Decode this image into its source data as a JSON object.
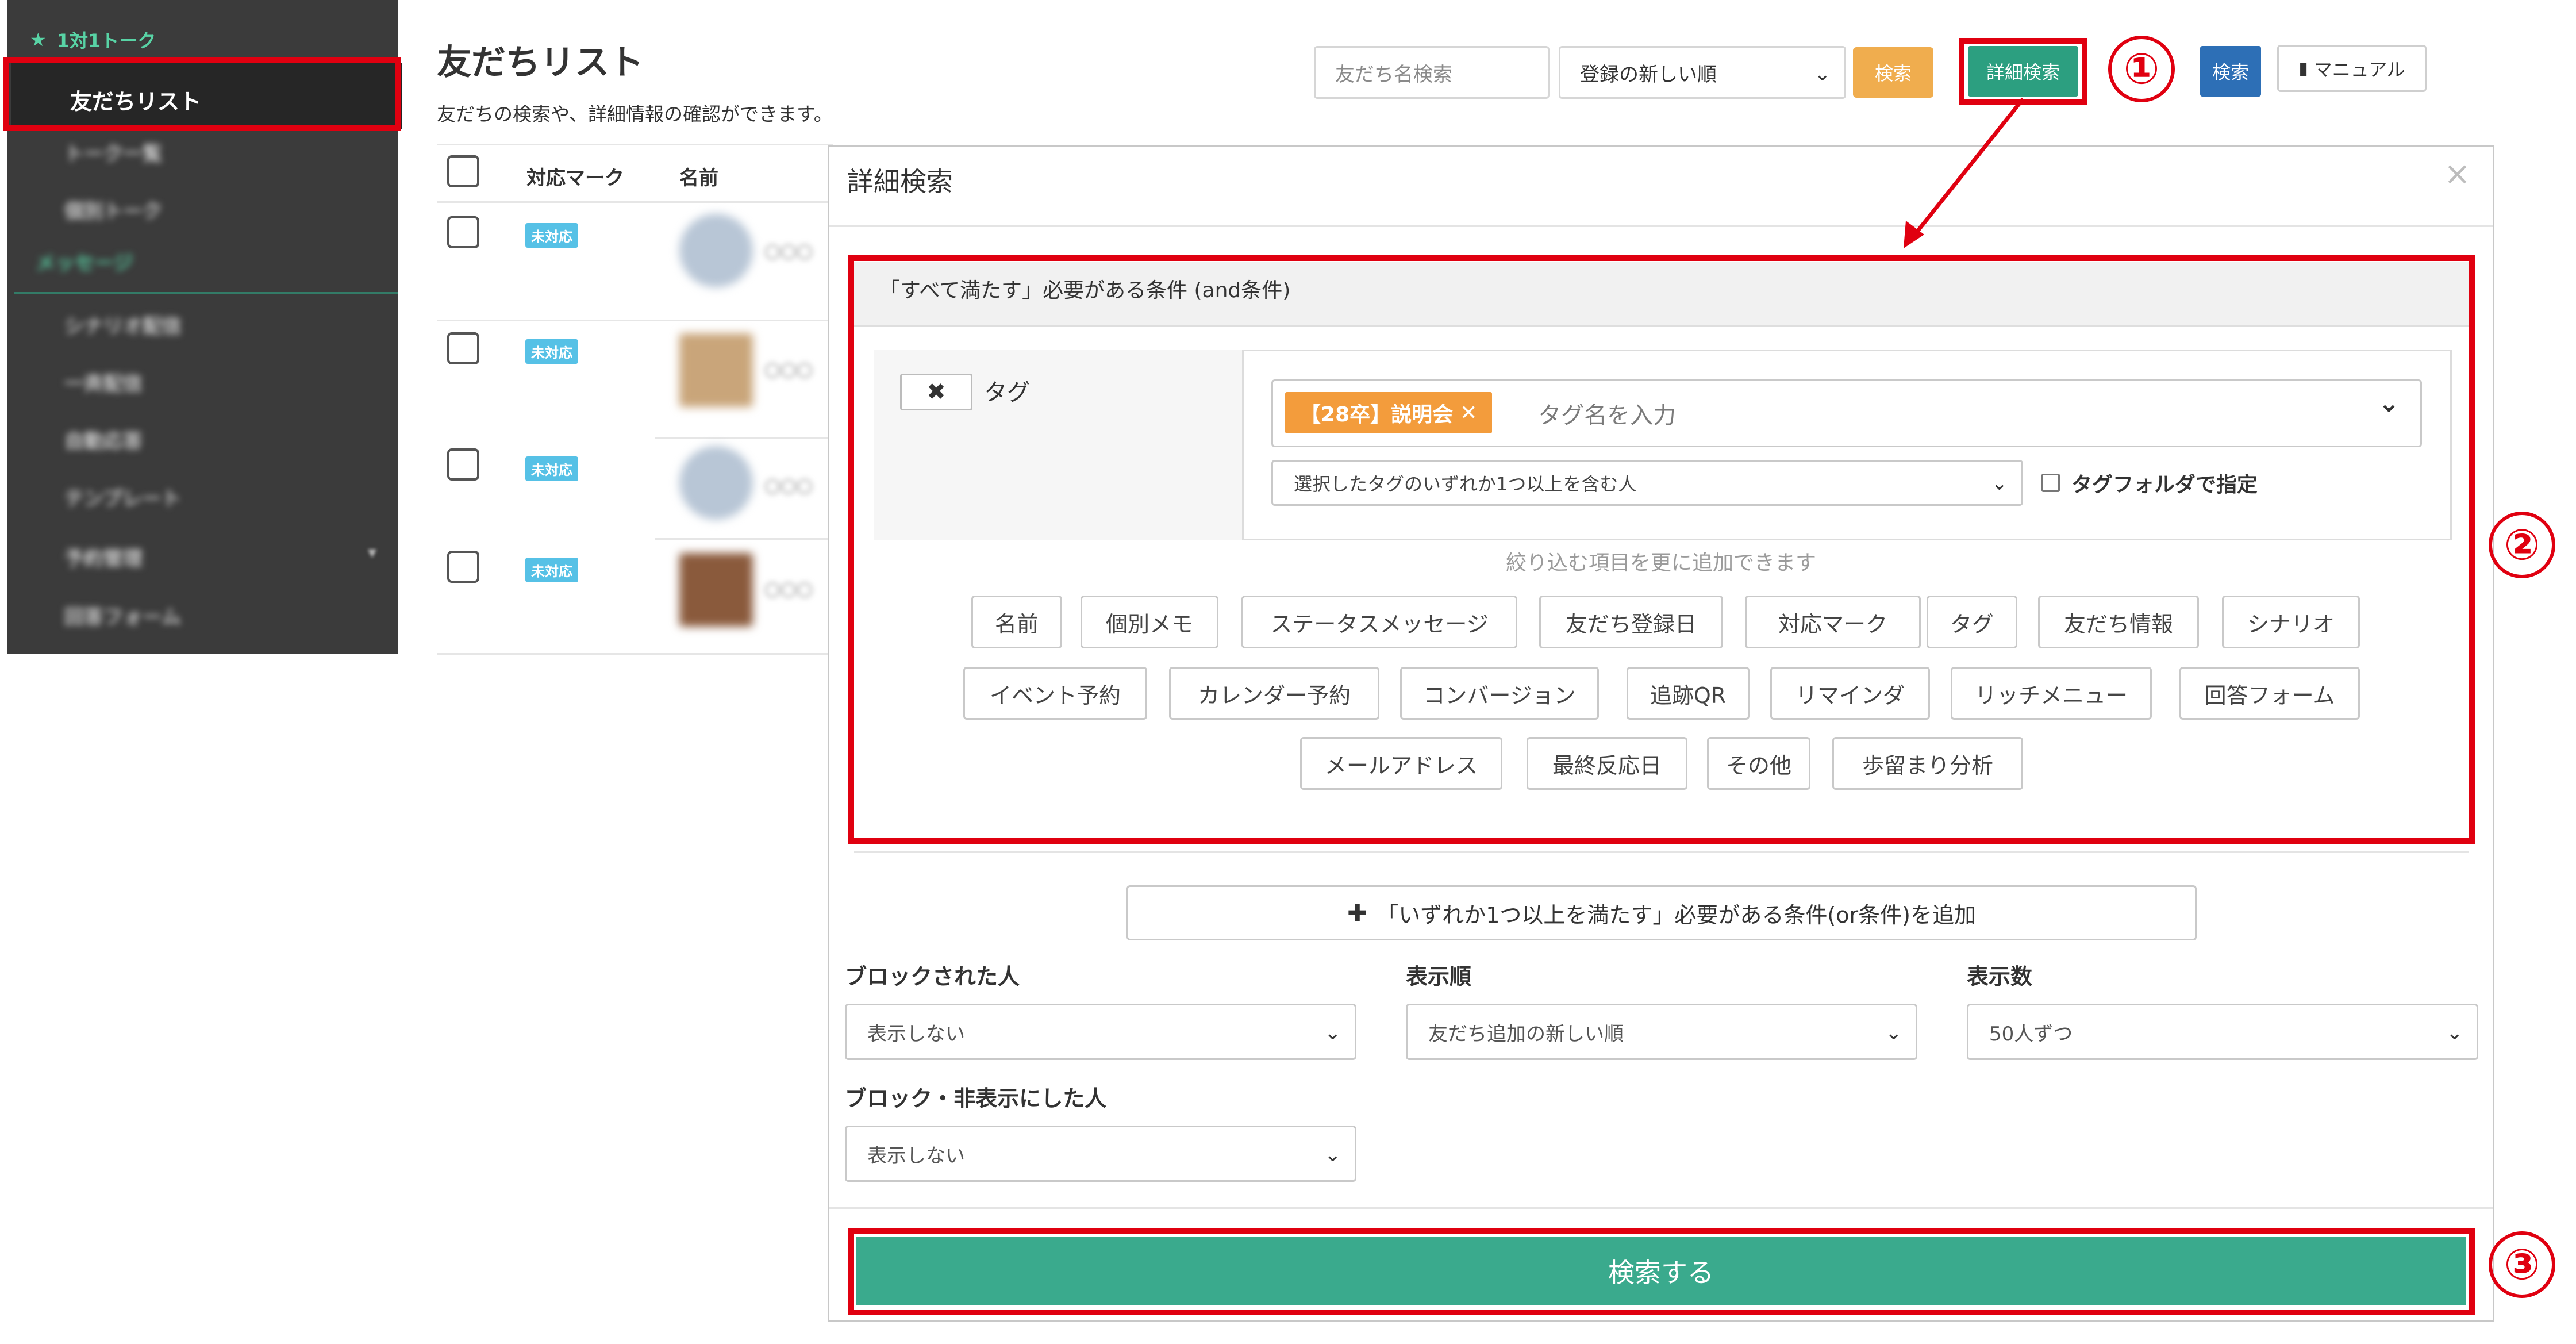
{
  "sidebar": {
    "section_title": "1対1トーク",
    "active_item": "友だちリスト",
    "items": [
      "トーク一覧",
      "個別トーク"
    ],
    "section2_title": "メッセージ",
    "items2": [
      "シナリオ配信",
      "一斉配信",
      "自動応答",
      "テンプレート",
      "予約管理",
      "回答フォーム"
    ]
  },
  "header": {
    "title": "友だちリスト",
    "description": "友だちの検索や、詳細情報の確認ができます。",
    "search_placeholder": "友だち名検索",
    "sort_value": "登録の新しい順",
    "search_button": "検索",
    "advanced_button": "詳細検索",
    "search_button2": "検索",
    "manual_button": "マニュアル"
  },
  "table": {
    "headers": [
      "対応マーク",
      "名前"
    ],
    "rows": [
      {
        "badge": "未対応",
        "name": "〇〇〇"
      },
      {
        "badge": "未対応",
        "name": "〇〇〇"
      },
      {
        "badge": "未対応",
        "name": "〇〇〇"
      },
      {
        "badge": "未対応",
        "name": "〇〇〇"
      }
    ]
  },
  "annotations": {
    "num1": "①",
    "num2": "②",
    "num3": "③"
  },
  "modal": {
    "title": "詳細検索",
    "close": "×",
    "and_condition_title": "「すべて満たす」必要がある条件 (and条件)",
    "remove_button": "✖",
    "condition_label": "タグ",
    "tag_chip": "【28卒】説明会",
    "tag_placeholder": "タグ名を入力",
    "match_mode": "選択したタグのいずれか1つ以上を含む人",
    "tag_folder_label": "タグフォルダで指定",
    "hint": "絞り込む項目を更に追加できます",
    "filter_rows": [
      [
        "名前",
        "個別メモ",
        "ステータスメッセージ",
        "友だち登録日",
        "対応マーク",
        "タグ",
        "友だち情報",
        "シナリオ"
      ],
      [
        "イベント予約",
        "カレンダー予約",
        "コンバージョン",
        "追跡QR",
        "リマインダ",
        "リッチメニュー",
        "回答フォーム"
      ],
      [
        "メールアドレス",
        "最終反応日",
        "その他",
        "歩留まり分析"
      ]
    ],
    "or_condition_button": "「いずれか1つ以上を満たす」必要がある条件(or条件)を追加",
    "fields": {
      "blocked_label": "ブロックされた人",
      "blocked_value": "表示しない",
      "order_label": "表示順",
      "order_value": "友だち追加の新しい順",
      "count_label": "表示数",
      "count_value": "50人ずつ",
      "blocked_hidden_label": "ブロック・非表示にした人",
      "blocked_hidden_value": "表示しない"
    },
    "submit_button": "検索する"
  },
  "colors": {
    "sidebar_bg": "#3b3b3b",
    "accent_green": "#2c9f80",
    "submit_green": "#3aaa8d",
    "orange": "#f0ad4e",
    "blue": "#2d6fb6",
    "annotation_red": "#e00010",
    "badge_blue": "#56c1e6"
  }
}
